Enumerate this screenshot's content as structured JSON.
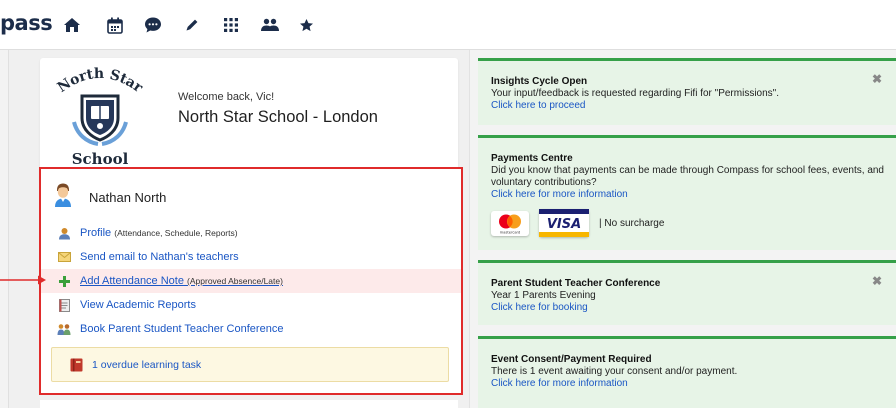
{
  "app": {
    "logo_text": "pass"
  },
  "nav_icons": [
    "home-icon",
    "calendar-icon",
    "chat-icon",
    "pencil-icon",
    "grid-icon",
    "people-icon",
    "star-icon"
  ],
  "school": {
    "crest_top_text": "North Star",
    "crest_bottom_text": "School",
    "welcome": "Welcome back, Vic!",
    "name": "North Star School - London"
  },
  "student": {
    "name": "Nathan North",
    "links": [
      {
        "label": "Profile",
        "sub": "(Attendance, Schedule, Reports)",
        "icon": "person-icon"
      },
      {
        "label": "Send email to Nathan's teachers",
        "sub": "",
        "icon": "envelope-icon"
      },
      {
        "label": "Add Attendance Note",
        "sub": "(Approved Absence/Late)",
        "icon": "plus-icon"
      },
      {
        "label": "View Academic Reports",
        "sub": "",
        "icon": "report-icon"
      },
      {
        "label": "Book Parent Student Teacher Conference",
        "sub": "",
        "icon": "conference-icon"
      }
    ],
    "overdue": "1 overdue learning task"
  },
  "panels": {
    "insights": {
      "title": "Insights Cycle Open",
      "line": "Your input/feedback is requested regarding Fifi for \"Permissions\".",
      "link": "Click here to proceed",
      "close": "✖"
    },
    "payments": {
      "title": "Payments Centre",
      "line": "Did you know that payments can be made through Compass for school fees, events, and voluntary contributions?",
      "link": "Click here for more information",
      "mastercard_label": "mastercard",
      "visa_label": "VISA",
      "surcharge": "|  No surcharge"
    },
    "conference": {
      "title": "Parent Student Teacher Conference",
      "line": "Year 1 Parents Evening",
      "link": "Click here for booking",
      "close": "✖"
    },
    "consent": {
      "title": "Event Consent/Payment Required",
      "line": "There is 1 event awaiting your consent and/or payment.",
      "link": "Click here for more information"
    }
  },
  "colors": {
    "accent_blue": "#1a56c4",
    "panel_green_border": "#36a049",
    "panel_green_bg": "#e7f4e7",
    "highlight_red": "#e02b2b"
  }
}
